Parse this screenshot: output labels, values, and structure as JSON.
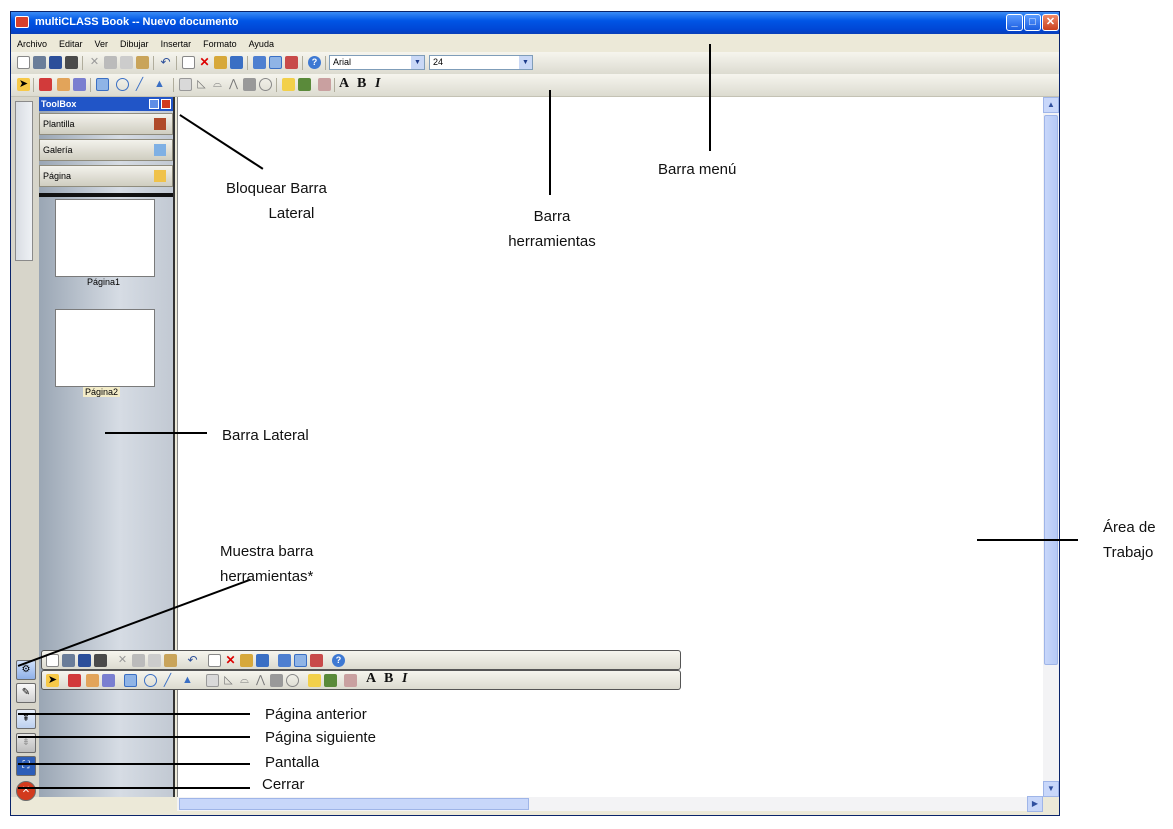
{
  "window": {
    "title": "multiCLASS Book -- Nuevo documento"
  },
  "menu": [
    "Archivo",
    "Editar",
    "Ver",
    "Dibujar",
    "Insertar",
    "Formato",
    "Ayuda"
  ],
  "toolbar": {
    "font_name": "Arial",
    "font_size": "24",
    "text_buttons": [
      "A",
      "B",
      "I"
    ]
  },
  "toolbox": {
    "title": "ToolBox",
    "sections": [
      "Plantilla",
      "Galería",
      "Página"
    ],
    "pages": [
      "Página1",
      "Página2"
    ]
  },
  "annotations": {
    "barra_menu": "Barra menú",
    "bloquear": "Bloquear Barra Lateral",
    "bloquear_l1": "Bloquear Barra",
    "bloquear_l2": "Lateral",
    "barra_herr_l1": "Barra",
    "barra_herr_l2": "herramientas",
    "barra_lateral": "Barra Lateral",
    "area_l1": "Área de",
    "area_l2": "Trabajo",
    "muestra_l1": "Muestra barra",
    "muestra_l2": "herramientas*",
    "pagina_anterior": "Página anterior",
    "pagina_siguiente": "Página siguiente",
    "pantalla": "Pantalla",
    "cerrar": "Cerrar"
  },
  "colors": {
    "titlebar": "#0055e5",
    "toolbox_header": "#2155c7",
    "close_button": "#c9401e"
  }
}
